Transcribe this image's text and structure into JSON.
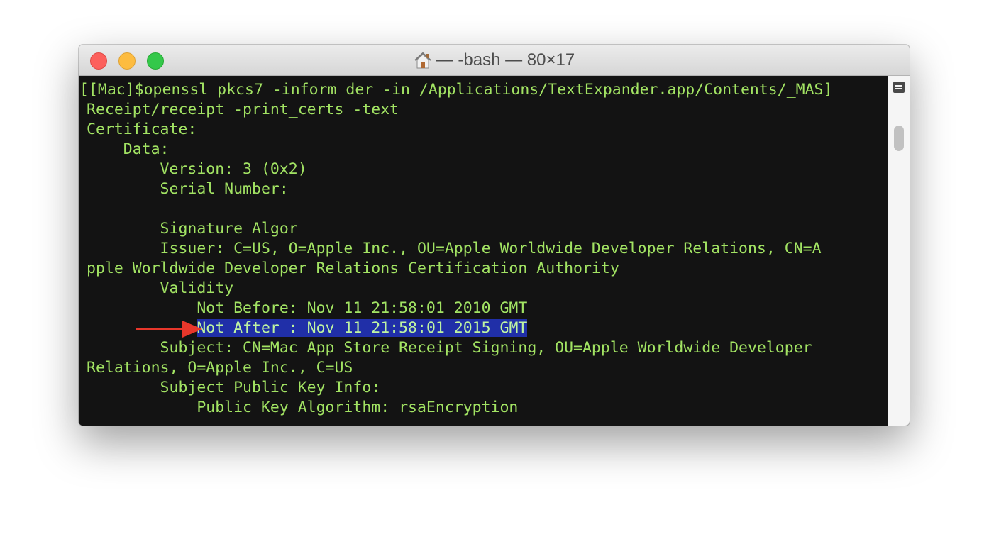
{
  "window": {
    "title": "— -bash — 80×17",
    "title_icon": "home-icon"
  },
  "terminal": {
    "lines": [
      "[[Mac]$openssl pkcs7 -inform der -in /Applications/TextExpander.app/Contents/_MAS]",
      "Receipt/receipt -print_certs -text",
      "Certificate:",
      "    Data:",
      "        Version: 3 (0x2)",
      "        Serial Number:",
      "",
      "        Signature Algor",
      "        Issuer: C=US, O=Apple Inc., OU=Apple Worldwide Developer Relations, CN=A",
      "pple Worldwide Developer Relations Certification Authority",
      "        Validity",
      "            Not Before: Nov 11 21:58:01 2010 GMT",
      "            Not After : Nov 11 21:58:01 2015 GMT",
      "        Subject: CN=Mac App Store Receipt Signing, OU=Apple Worldwide Developer",
      "Relations, O=Apple Inc., C=US",
      "        Subject Public Key Info:",
      "            Public Key Algorithm: rsaEncryption"
    ],
    "selected_line_indent": "            ",
    "selected_text": "Not After : Nov 11 21:58:01 2015 GMT"
  },
  "colors": {
    "terminal_background": "#131313",
    "terminal_text": "#a2e363",
    "selection_background": "#202fa8",
    "annotation_arrow": "#e8372b"
  },
  "annotation": {
    "icon": "red-arrow-icon"
  }
}
